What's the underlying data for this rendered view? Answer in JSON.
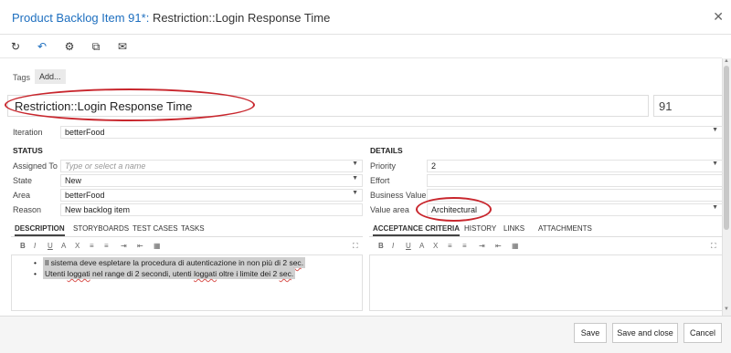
{
  "window": {
    "title_prefix": "Product Backlog Item 91*:",
    "title_main": "Restriction::Login Response Time",
    "close_icon": "close-icon"
  },
  "toolbar": {
    "icons": [
      "refresh-icon",
      "undo-icon",
      "workflow-icon",
      "copy-icon",
      "email-icon"
    ]
  },
  "tags": {
    "label": "Tags",
    "add_label": "Add..."
  },
  "item": {
    "title": "Restriction::Login Response Time",
    "id": "91"
  },
  "iteration": {
    "label": "Iteration",
    "value": "betterFood"
  },
  "status": {
    "heading": "STATUS",
    "assigned_to": {
      "label": "Assigned To",
      "placeholder": "Type or select a name"
    },
    "state": {
      "label": "State",
      "value": "New"
    },
    "area": {
      "label": "Area",
      "value": "betterFood"
    },
    "reason": {
      "label": "Reason",
      "value": "New backlog item"
    }
  },
  "details": {
    "heading": "DETAILS",
    "priority": {
      "label": "Priority",
      "value": "2"
    },
    "effort": {
      "label": "Effort",
      "value": ""
    },
    "business_value": {
      "label": "Business Value",
      "value": ""
    },
    "value_area": {
      "label": "Value area",
      "value": "Architectural"
    }
  },
  "left_tabs": [
    "DESCRIPTION",
    "STORYBOARDS",
    "TEST CASES",
    "TASKS"
  ],
  "right_tabs": [
    "ACCEPTANCE CRITERIA",
    "HISTORY",
    "LINKS",
    "ATTACHMENTS"
  ],
  "rte_buttons": [
    "B",
    "I",
    "U",
    "A",
    "X",
    "≡",
    "≡",
    "⇥",
    "⇤",
    "▦"
  ],
  "description": {
    "line1_a": "Il sistema deve espletare la procedura di autenticazione in non più di 2 ",
    "line1_b": "sec",
    "line1_c": ".",
    "line2_a": "Utenti ",
    "line2_b": "loggati",
    "line2_c": " nel range di 2 secondi, utenti ",
    "line2_d": "loggati",
    "line2_e": " oltre i limite dei 2 ",
    "line2_f": "sec",
    "line2_g": "."
  },
  "footer": {
    "save": "Save",
    "save_close": "Save and close",
    "cancel": "Cancel"
  },
  "colors": {
    "accent": "#1e6fbf",
    "annotation": "#c8262d"
  }
}
